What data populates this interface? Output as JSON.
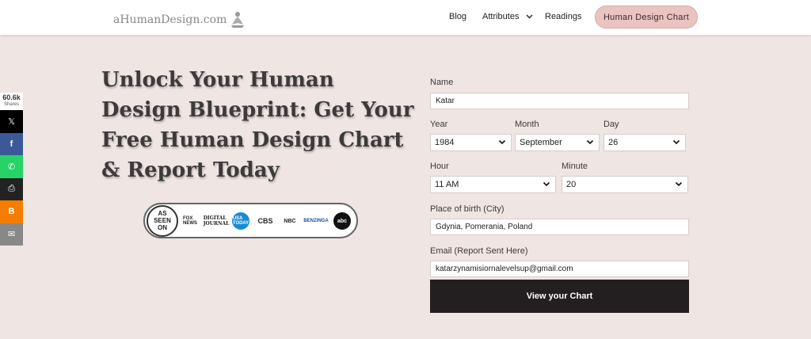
{
  "header": {
    "logo_text": "aHumanDesign.com",
    "nav": [
      {
        "label": "Blog"
      },
      {
        "label": "Attributes"
      },
      {
        "label": "Readings"
      }
    ],
    "cta_label": "Human Design Chart"
  },
  "share": {
    "count": "60.6k",
    "count_label": "Shares",
    "buttons": [
      {
        "name": "x",
        "glyph": "𝕏",
        "color": "#000000"
      },
      {
        "name": "facebook",
        "glyph": "f",
        "color": "#3b5998"
      },
      {
        "name": "whatsapp",
        "glyph": "✆",
        "color": "#25d366"
      },
      {
        "name": "print",
        "glyph": "⎙",
        "color": "#222222"
      },
      {
        "name": "blogger",
        "glyph": "B",
        "color": "#f57d00"
      },
      {
        "name": "email",
        "glyph": "✉",
        "color": "#888888"
      }
    ]
  },
  "hero": {
    "headline": "Unlock Your Human Design Blueprint: Get Your Free Human Design Chart & Report Today"
  },
  "seen_on": {
    "badge": [
      "AS",
      "SEEN",
      "ON"
    ],
    "logos": [
      "FOX NEWS",
      "DIGITAL JOURNAL",
      "USA TODAY",
      "CBS",
      "NBC",
      "BENZINGA",
      "abc"
    ]
  },
  "form": {
    "name_label": "Name",
    "name_value": "Katar",
    "year_label": "Year",
    "year_value": "1984",
    "month_label": "Month",
    "month_value": "September",
    "day_label": "Day",
    "day_value": "26",
    "hour_label": "Hour",
    "hour_value": "11 AM",
    "minute_label": "Minute",
    "minute_value": "20",
    "place_label": "Place of birth (City)",
    "place_value": "Gdynia, Pomerania, Poland",
    "email_label": "Email (Report Sent Here)",
    "email_value": "katarzynamisiornalevelsup@gmail.com",
    "submit_label": "View your Chart"
  },
  "colors": {
    "background": "#efe5e3",
    "cta": "#e9c4c0",
    "submit": "#231f20"
  }
}
